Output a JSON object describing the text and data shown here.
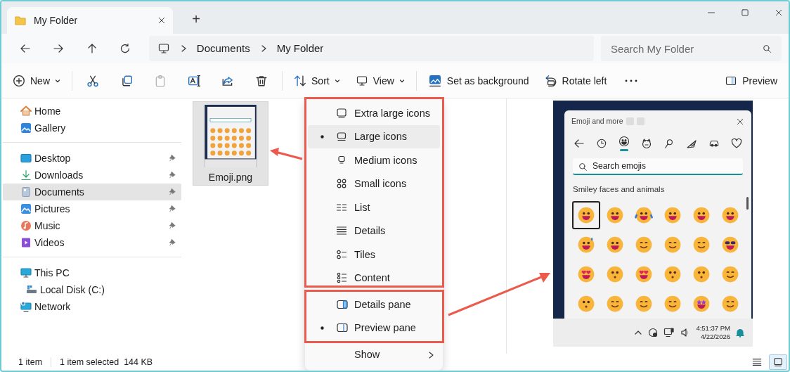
{
  "window": {
    "tab_title": "My Folder",
    "new_tab": "+"
  },
  "address_bar": {
    "segments": [
      "Documents",
      "My Folder"
    ]
  },
  "search": {
    "placeholder": "Search My Folder"
  },
  "toolbar": {
    "groups": [
      [
        {
          "kind": "new",
          "label": "New",
          "dropdown": true,
          "disabled": false
        }
      ],
      [
        {
          "kind": "cut",
          "disabled": false
        },
        {
          "kind": "copy",
          "disabled": false
        },
        {
          "kind": "paste",
          "disabled": true
        },
        {
          "kind": "rename",
          "disabled": false
        },
        {
          "kind": "share",
          "disabled": false
        },
        {
          "kind": "delete",
          "disabled": false
        }
      ],
      [
        {
          "kind": "sort",
          "label": "Sort",
          "dropdown": true,
          "disabled": false
        },
        {
          "kind": "view",
          "label": "View",
          "dropdown": true,
          "disabled": false
        }
      ],
      [
        {
          "kind": "background",
          "label": "Set as background",
          "dropdown": false,
          "disabled": false
        },
        {
          "kind": "rotate",
          "label": "Rotate left",
          "dropdown": false,
          "disabled": false
        },
        {
          "kind": "more",
          "disabled": false
        }
      ],
      [
        {
          "kind": "preview",
          "label": "Preview",
          "dropdown": false,
          "disabled": false
        }
      ]
    ]
  },
  "sidebar": {
    "groups": [
      [
        {
          "kind": "home",
          "label": "Home",
          "pinned": false,
          "selected": false
        },
        {
          "kind": "gallery",
          "label": "Gallery",
          "pinned": false,
          "selected": false
        }
      ],
      [
        {
          "kind": "desktop",
          "label": "Desktop",
          "pinned": true,
          "selected": false
        },
        {
          "kind": "downloads",
          "label": "Downloads",
          "pinned": true,
          "selected": false
        },
        {
          "kind": "documents",
          "label": "Documents",
          "pinned": true,
          "selected": true
        },
        {
          "kind": "pictures",
          "label": "Pictures",
          "pinned": true,
          "selected": false
        },
        {
          "kind": "music",
          "label": "Music",
          "pinned": true,
          "selected": false
        },
        {
          "kind": "videos",
          "label": "Videos",
          "pinned": true,
          "selected": false
        }
      ],
      [
        {
          "kind": "pc",
          "label": "This PC",
          "pinned": false,
          "selected": false,
          "children": [
            {
              "kind": "disk",
              "label": "Local Disk (C:)",
              "pinned": false,
              "selected": false
            }
          ]
        },
        {
          "kind": "network",
          "label": "Network",
          "pinned": false,
          "selected": false
        }
      ]
    ]
  },
  "files": [
    {
      "name": "Emoji.png",
      "selected": true
    }
  ],
  "view_menu": {
    "sections": [
      [
        {
          "kind": "xl",
          "label": "Extra large icons",
          "selected": false,
          "hovered": false
        },
        {
          "kind": "large",
          "label": "Large icons",
          "selected": true,
          "hovered": true
        },
        {
          "kind": "medium",
          "label": "Medium icons",
          "selected": false,
          "hovered": false
        },
        {
          "kind": "small",
          "label": "Small icons",
          "selected": false,
          "hovered": false
        },
        {
          "kind": "list",
          "label": "List",
          "selected": false,
          "hovered": false
        },
        {
          "kind": "details",
          "label": "Details",
          "selected": false,
          "hovered": false
        },
        {
          "kind": "tiles",
          "label": "Tiles",
          "selected": false,
          "hovered": false
        },
        {
          "kind": "content",
          "label": "Content",
          "selected": false,
          "hovered": false
        }
      ],
      [
        {
          "kind": "details_pane",
          "label": "Details pane",
          "selected": false,
          "hovered": false
        },
        {
          "kind": "preview_pane",
          "label": "Preview pane",
          "selected": true,
          "hovered": false
        }
      ],
      [
        {
          "kind": "submenu",
          "label": "Show",
          "selected": false,
          "hovered": false
        }
      ]
    ]
  },
  "preview": {
    "panel_title": "Emoji and more",
    "search_placeholder": "Search emojis",
    "section": "Smiley faces and animals",
    "categories": [
      {
        "kind": "back",
        "selected": false
      },
      {
        "kind": "recent",
        "selected": false
      },
      {
        "kind": "smiley",
        "selected": true
      },
      {
        "kind": "animal",
        "selected": false
      },
      {
        "kind": "food",
        "selected": false
      },
      {
        "kind": "celebrate",
        "selected": false
      },
      {
        "kind": "car",
        "selected": false
      },
      {
        "kind": "heart",
        "selected": false
      }
    ],
    "emojis": [
      {
        "kind": "grin",
        "focused": true
      },
      {
        "kind": "grin",
        "focused": false
      },
      {
        "kind": "tears",
        "focused": false
      },
      {
        "kind": "grin",
        "focused": false
      },
      {
        "kind": "grin",
        "focused": false
      },
      {
        "kind": "grin",
        "focused": false
      },
      {
        "kind": "sweat",
        "focused": false
      },
      {
        "kind": "grin",
        "focused": false
      },
      {
        "kind": "smile",
        "focused": false
      },
      {
        "kind": "smile",
        "focused": false
      },
      {
        "kind": "smile",
        "focused": false
      },
      {
        "kind": "shades",
        "focused": false
      },
      {
        "kind": "hearts",
        "focused": false
      },
      {
        "kind": "kiss",
        "focused": false
      },
      {
        "kind": "hearts",
        "focused": false
      },
      {
        "kind": "kiss",
        "focused": false
      },
      {
        "kind": "kiss",
        "focused": false
      },
      {
        "kind": "smile",
        "focused": false
      },
      {
        "kind": "kiss",
        "focused": false
      },
      {
        "kind": "smile",
        "focused": false
      },
      {
        "kind": "smile",
        "focused": false
      },
      {
        "kind": "smile",
        "focused": false
      },
      {
        "kind": "stars",
        "focused": false
      },
      {
        "kind": "smile",
        "focused": false
      }
    ],
    "time": "4:51:37 PM",
    "date": "4/22/2026"
  },
  "status_bar": {
    "count": "1 item",
    "selection": "1 item selected",
    "size": "144 KB",
    "views": [
      {
        "kind": "details",
        "selected": false
      },
      {
        "kind": "large",
        "selected": true
      }
    ]
  }
}
